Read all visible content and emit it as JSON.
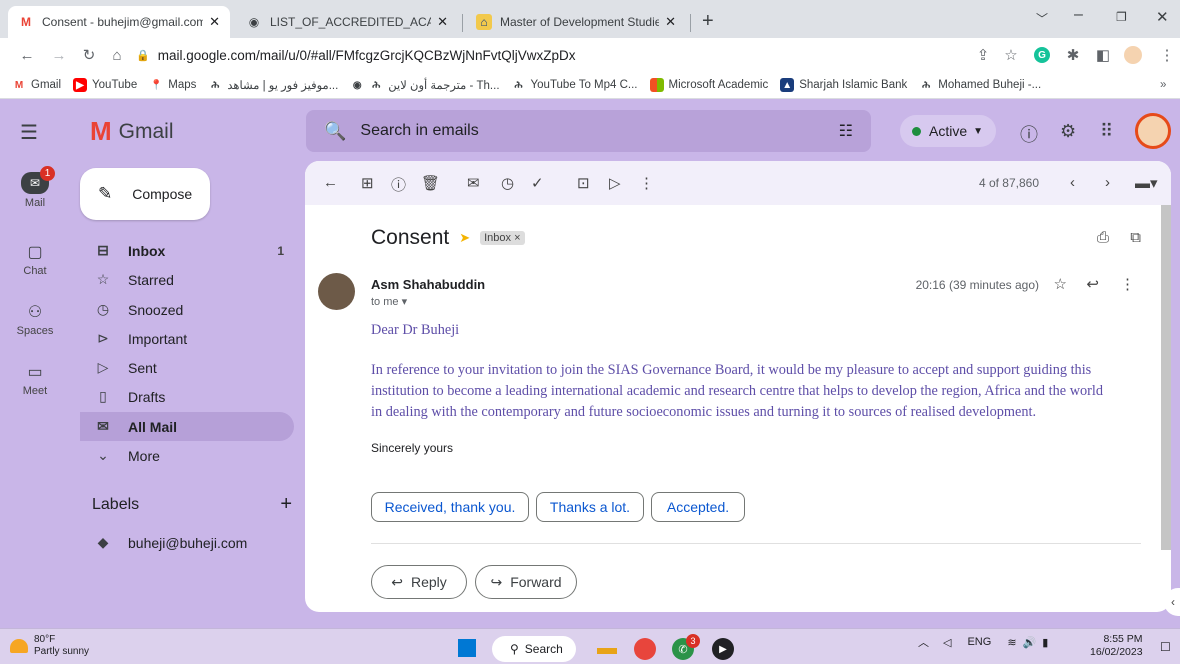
{
  "browser": {
    "tabs": [
      {
        "title": "Consent - buhejim@gmail.com - ",
        "icon": "gmail-icon"
      },
      {
        "title": "LIST_OF_ACCREDITED_ACADEMIC",
        "icon": "globe-icon"
      },
      {
        "title": "Master of Development Studies - ",
        "icon": "university-icon"
      }
    ],
    "new_tab": "+",
    "url": "mail.google.com/mail/u/0/#all/FMfcgzGrcjKQCBzWjNnFvtQljVwxZpDx",
    "bookmarks": [
      "Gmail",
      "YouTube",
      "Maps",
      "موفيز فور يو | مشاهد...",
      "مترجمة أون لاين - Th...",
      "YouTube To Mp4 C...",
      "Microsoft Academic",
      "Sharjah Islamic Bank",
      "Mohamed Buheji -..."
    ],
    "bookmarks_more": "»"
  },
  "gmail": {
    "logo_text": "Gmail",
    "search_placeholder": "Search in emails",
    "status": "Active",
    "rail": [
      {
        "label": "Mail",
        "icon": "mail-icon",
        "badge": "1"
      },
      {
        "label": "Chat",
        "icon": "chat-icon"
      },
      {
        "label": "Spaces",
        "icon": "spaces-icon"
      },
      {
        "label": "Meet",
        "icon": "meet-icon"
      }
    ],
    "compose": "Compose",
    "folders": [
      {
        "label": "Inbox",
        "icon": "inbox-icon",
        "count": "1"
      },
      {
        "label": "Starred",
        "icon": "star-icon"
      },
      {
        "label": "Snoozed",
        "icon": "clock-icon"
      },
      {
        "label": "Important",
        "icon": "important-icon"
      },
      {
        "label": "Sent",
        "icon": "send-icon"
      },
      {
        "label": "Drafts",
        "icon": "draft-icon"
      },
      {
        "label": "All Mail",
        "icon": "all-mail-icon"
      },
      {
        "label": "More",
        "icon": "chevron-down-icon"
      }
    ],
    "labels_title": "Labels",
    "labels_add": "+",
    "labels": [
      "buheji@buheji.com"
    ]
  },
  "message": {
    "pager": "4 of 87,860",
    "subject": "Consent",
    "label_chip": "Inbox ×",
    "sender": "Asm Shahabuddin",
    "to": "to me ▾",
    "time": "20:16 (39 minutes ago)",
    "greeting": "Dear Dr Buheji",
    "paragraph_lines": [
      "In reference to your invitation to join the SIAS Governance Board, it would be my pleasure to accept and support guiding this",
      "institution to become a leading international academic and research centre that helps to develop the region, Africa and the world",
      "in dealing with the contemporary and future socioeconomic issues and turning it to sources of realised development."
    ],
    "signoff": "Sincerely yours",
    "smart_replies": [
      "Received, thank you.",
      "Thanks a lot.",
      "Accepted."
    ],
    "reply": "Reply",
    "forward": "Forward"
  },
  "taskbar": {
    "temp": "80°F",
    "weather": "Partly sunny",
    "search": "Search",
    "lang": "ENG",
    "time": "8:55 PM",
    "date": "16/02/2023",
    "chat_badge": "3"
  },
  "colors": {
    "bg": "#c9b6e8",
    "accent": "#0b57d0",
    "body_text": "#5e4ea8"
  }
}
